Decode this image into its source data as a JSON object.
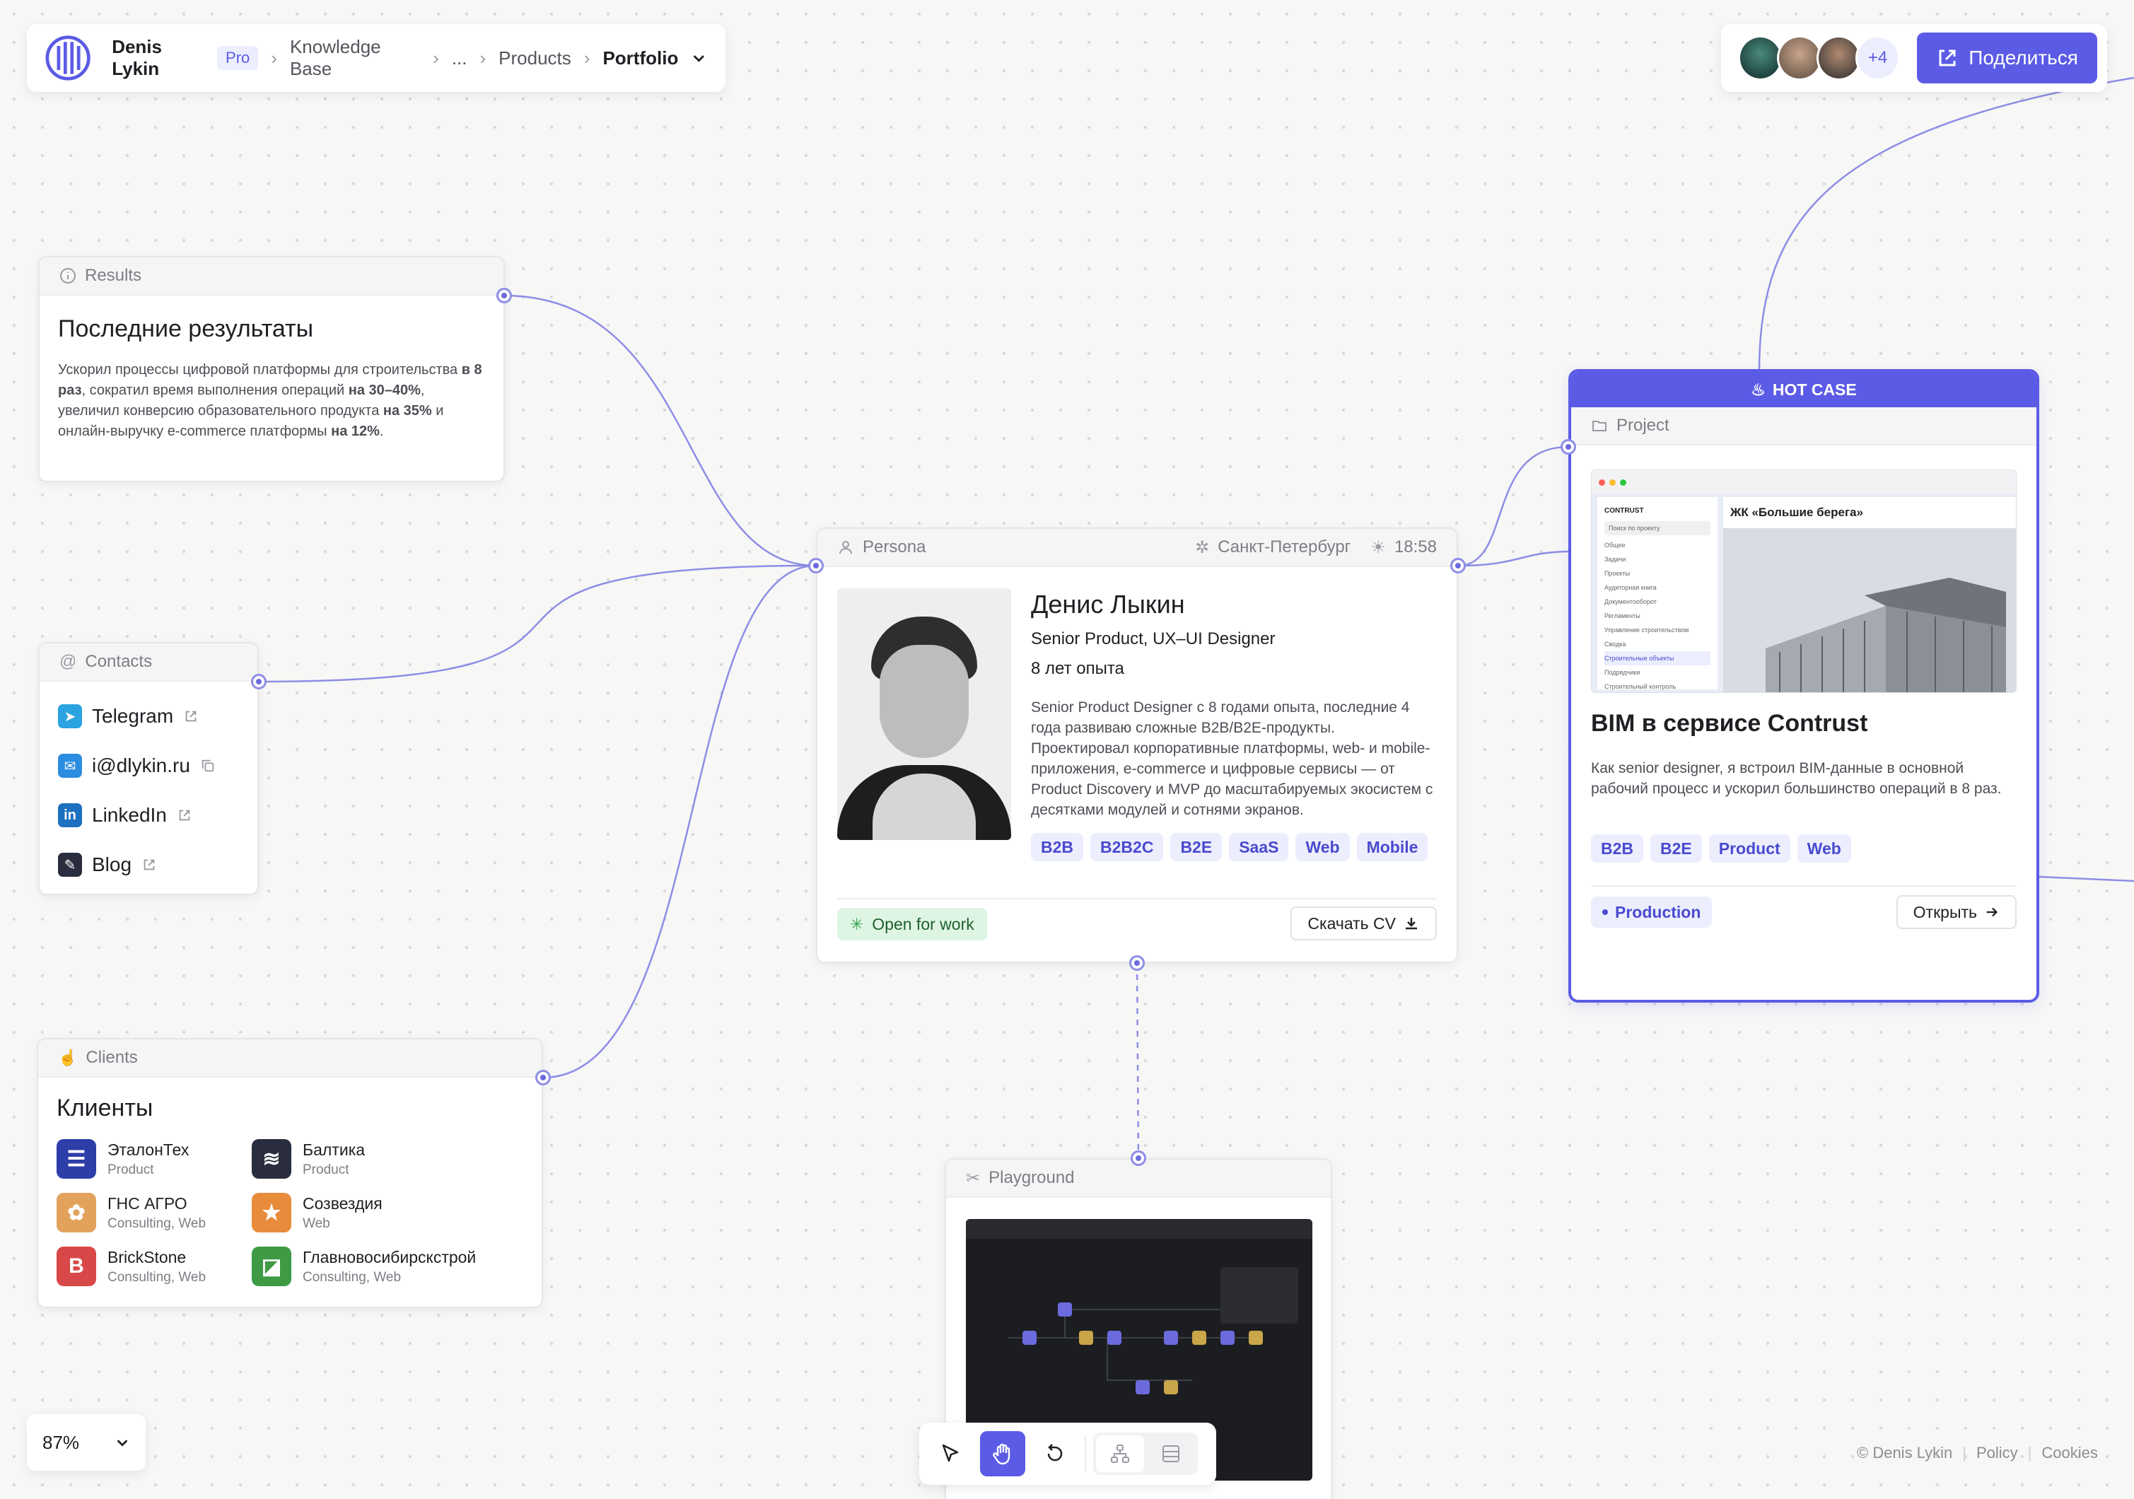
{
  "topbar": {
    "user": "Denis Lykin",
    "plan": "Pro",
    "breadcrumb": [
      "Knowledge Base",
      "...",
      "Products"
    ],
    "current": "Portfolio"
  },
  "collab": {
    "more": "+4",
    "share": "Поделиться"
  },
  "results": {
    "header": "Results",
    "title": "Последние результаты",
    "text_parts": [
      "Ускорил процессы цифровой платформы для строительства ",
      "в 8 раз",
      ", сократил время выполнения операций ",
      "на 30–40%",
      ", увеличил конверсию образовательного продукта ",
      "на 35%",
      " и онлайн-выручку e-commerce платформы ",
      "на 12%",
      "."
    ]
  },
  "contacts": {
    "header": "Contacts",
    "items": [
      "Telegram",
      "i@dlykin.ru",
      "LinkedIn",
      "Blog"
    ]
  },
  "persona": {
    "header": "Persona",
    "city": "Санкт-Петербург",
    "time": "18:58",
    "name": "Денис Лыкин",
    "role": "Senior Product, UX–UI Designer",
    "experience": "8 лет опыта",
    "bio": "Senior Product Designer с 8 годами опыта, последние 4 года развиваю сложные B2B/B2E-продукты. Проектировал корпоративные платформы, web- и mobile-приложения, e-commerce и цифровые сервисы — от Product Discovery и MVP до масштабируемых экосистем с десятками модулей и сотнями экранов.",
    "tags": [
      "B2B",
      "B2B2C",
      "B2E",
      "SaaS",
      "Web",
      "Mobile"
    ],
    "status": "Open for work",
    "cv": "Скачать CV"
  },
  "project": {
    "banner": "HOT CASE",
    "header": "Project",
    "title": "BIM в сервисе Contrust",
    "text": "Как senior designer, я встроил BIM-данные в основной рабочий процесс и ускорил большинство операций в 8 раз.",
    "tags": [
      "B2B",
      "B2E",
      "Product",
      "Web"
    ],
    "status": "Production",
    "open": "Открыть",
    "preview": {
      "brand": "CONTRUST",
      "search": "Поиск по проекту",
      "heading": "ЖК «Большие берега»",
      "group": "Общее",
      "items": [
        "Задачи",
        "Проекты",
        "Аудиторная книга",
        "Документооборот",
        "Регламенты"
      ],
      "section": "Управление строительством",
      "items2": [
        "Сводка",
        "Строительные объекты",
        "Подрядчики",
        "Строительный контроль"
      ]
    }
  },
  "clients": {
    "header": "Clients",
    "title": "Клиенты",
    "items": [
      {
        "name": "ЭталонТех",
        "sub": "Product",
        "color": "#2d3ea8",
        "glyph": "☰"
      },
      {
        "name": "Балтика",
        "sub": "Product",
        "color": "#2a2d3d",
        "glyph": "≋"
      },
      {
        "name": "ГНС АГРО",
        "sub": "Consulting, Web",
        "color": "#e3a25c",
        "glyph": "✿"
      },
      {
        "name": "Созвездия",
        "sub": "Web",
        "color": "#e88c3c",
        "glyph": "★"
      },
      {
        "name": "BrickStone",
        "sub": "Consulting, Web",
        "color": "#d94848",
        "glyph": "B"
      },
      {
        "name": "Главновосибирскстрой",
        "sub": "Consulting, Web",
        "color": "#3e9a45",
        "glyph": "◪"
      }
    ]
  },
  "playground": {
    "header": "Playground"
  },
  "zoom": {
    "value": "87%"
  },
  "footer": {
    "copyright": "© Denis Lykin",
    "policy": "Policy",
    "cookies": "Cookies"
  },
  "colors": {
    "accent": "#5b5be6",
    "tag_bg": "#eceefd",
    "status_green": "#dff5e3"
  }
}
